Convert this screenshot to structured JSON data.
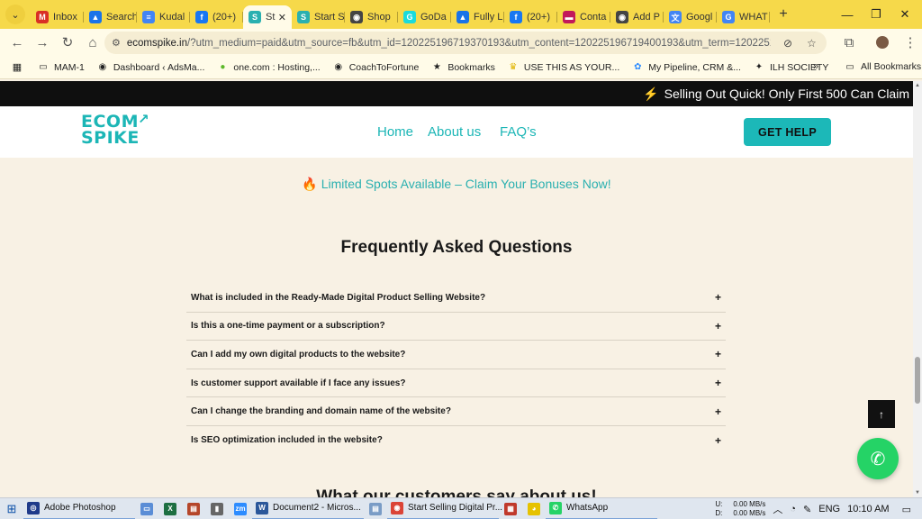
{
  "browser": {
    "tabs": [
      {
        "label": "Inbox",
        "icon": "gmail-icon",
        "color": "#d93025",
        "glyph": "M"
      },
      {
        "label": "Search",
        "icon": "drive-icon",
        "color": "#1a73e8",
        "glyph": "▲"
      },
      {
        "label": "Kudal",
        "icon": "docs-icon",
        "color": "#4285f4",
        "glyph": "≡"
      },
      {
        "label": "(20+)",
        "icon": "facebook-icon",
        "color": "#1877f2",
        "glyph": "f"
      },
      {
        "label": "St",
        "icon": "site-icon",
        "color": "#2ab0b0",
        "glyph": "S",
        "active": true
      },
      {
        "label": "Start S",
        "icon": "site-icon",
        "color": "#2ab0b0",
        "glyph": "S"
      },
      {
        "label": "Shop",
        "icon": "globe-icon",
        "color": "#444444",
        "glyph": "◉"
      },
      {
        "label": "GoDa",
        "icon": "godaddy-icon",
        "color": "#1bdbdb",
        "glyph": "G"
      },
      {
        "label": "Fully L",
        "icon": "drive-icon",
        "color": "#1a73e8",
        "glyph": "▲"
      },
      {
        "label": "(20+)",
        "icon": "facebook-icon",
        "color": "#1877f2",
        "glyph": "f"
      },
      {
        "label": "Conta",
        "icon": "contact-icon",
        "color": "#c2185b",
        "glyph": "▬"
      },
      {
        "label": "Add P",
        "icon": "globe-icon",
        "color": "#444444",
        "glyph": "◉"
      },
      {
        "label": "Googl",
        "icon": "translate-icon",
        "color": "#4285f4",
        "glyph": "文"
      },
      {
        "label": "WHAT",
        "icon": "google-icon",
        "color": "#4285f4",
        "glyph": "G"
      }
    ],
    "url_host": "ecomspike.in",
    "url_rest": "/?utm_medium=paid&utm_source=fb&utm_id=120225196719370193&utm_content=120225196719400193&utm_term=120225196719360...",
    "bookmarks": [
      {
        "label": "MAM-1",
        "icon": "folder-icon",
        "glyph": "▭"
      },
      {
        "label": "Dashboard ‹ AdsMa...",
        "icon": "globe-icon",
        "glyph": "◉"
      },
      {
        "label": "one.com : Hosting,...",
        "icon": "onecom-icon",
        "glyph": "●"
      },
      {
        "label": "CoachToFortune",
        "icon": "globe-icon",
        "glyph": "◉"
      },
      {
        "label": "Bookmarks",
        "icon": "star-icon",
        "glyph": "★"
      },
      {
        "label": "USE THIS AS YOUR...",
        "icon": "crown-icon",
        "glyph": "♛"
      },
      {
        "label": "My Pipeline, CRM &...",
        "icon": "pipeline-icon",
        "glyph": "✿"
      },
      {
        "label": "ILH SOCIETY",
        "icon": "society-icon",
        "glyph": "✦"
      }
    ],
    "all_bookmarks": "All Bookmarks",
    "more": "»"
  },
  "page": {
    "promo": "Selling Out Quick! Only First 500 Can Claim",
    "promo_icon": "⚡",
    "logo_line1": "ECOM",
    "logo_line2": "SPIKE",
    "nav": [
      "Home",
      "About us",
      "FAQ’s"
    ],
    "cta": "GET HELP",
    "limited_icon": "🔥",
    "limited": "Limited Spots Available – Claim Your Bonuses Now!",
    "faq_title": "Frequently Asked Questions",
    "faqs": [
      "What is included in the Ready-Made Digital Product Selling Website?",
      "Is this a one-time payment or a subscription?",
      "Can I add my own digital products to the website?",
      "Is customer support available if I face any issues?",
      "Can I change the branding and domain name of the website?",
      "Is SEO optimization included in the website?"
    ],
    "faq_toggle": "+",
    "customers_title": "What our customers say about us!",
    "back_top": "↑",
    "accent": "#1cb6b6"
  },
  "taskbar": {
    "apps": [
      {
        "label": "Adobe Photoshop",
        "icon": "photoshop-icon",
        "color": "#1f3a8a",
        "glyph": "◎",
        "wide": true
      },
      {
        "label": "",
        "icon": "monitor-icon",
        "color": "#5a8dd6",
        "glyph": "▭"
      },
      {
        "label": "",
        "icon": "excel-icon",
        "color": "#1d6f42",
        "glyph": "X"
      },
      {
        "label": "",
        "icon": "app-icon",
        "color": "#b5462a",
        "glyph": "▤"
      },
      {
        "label": "",
        "icon": "mic-icon",
        "color": "#666666",
        "glyph": "▮"
      },
      {
        "label": "",
        "icon": "zoom-icon",
        "color": "#2d8cff",
        "glyph": "zm"
      },
      {
        "label": "Document2 - Micros...",
        "icon": "word-icon",
        "color": "#2b579a",
        "glyph": "W",
        "wide": true
      },
      {
        "label": "",
        "icon": "notepad-icon",
        "color": "#7a9cc6",
        "glyph": "▤"
      },
      {
        "label": "Start Selling Digital Pr...",
        "icon": "chrome-icon",
        "color": "#db4437",
        "glyph": "◉",
        "wide": true
      },
      {
        "label": "",
        "icon": "app-icon",
        "color": "#c0392b",
        "glyph": "▦"
      },
      {
        "label": "",
        "icon": "snapchat-icon",
        "color": "#e6c200",
        "glyph": "◕"
      },
      {
        "label": "WhatsApp",
        "icon": "whatsapp-icon",
        "color": "#25d366",
        "glyph": "✆",
        "wide": true
      }
    ],
    "net_up_label": "U:",
    "net_down_label": "D:",
    "net_up": "0.00 MB/s",
    "net_down": "0.00 MB/s",
    "lang": "ENG",
    "time": "10:10 AM"
  }
}
